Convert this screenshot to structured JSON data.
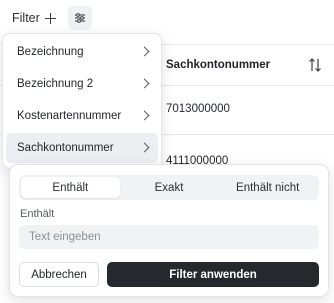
{
  "toolbar": {
    "filter_label": "Filter",
    "plus_icon": "plus-icon",
    "settings_icon": "sliders-icon"
  },
  "table": {
    "column_header": "Sachkontonummer",
    "sort_icon": "sort-arrows-icon",
    "rows": [
      "7013000000",
      "4111000000"
    ]
  },
  "menu": {
    "items": [
      {
        "label": "Bezeichnung"
      },
      {
        "label": "Bezeichnung 2"
      },
      {
        "label": "Kostenartennummer"
      },
      {
        "label": "Sachkontonummer",
        "selected": true
      }
    ],
    "chevron_icon": "chevron-right-icon"
  },
  "popover": {
    "modes": [
      "Enthält",
      "Exakt",
      "Enthält nicht"
    ],
    "active_mode": "Enthält",
    "field_label": "Enthält",
    "input_value": "",
    "input_placeholder": "Text eingeben",
    "cancel_label": "Abbrechen",
    "apply_label": "Filter anwenden"
  },
  "colors": {
    "primary_button": "#25282c",
    "selected_item_bg": "#eceef1",
    "input_bg": "#f1f2f4"
  }
}
